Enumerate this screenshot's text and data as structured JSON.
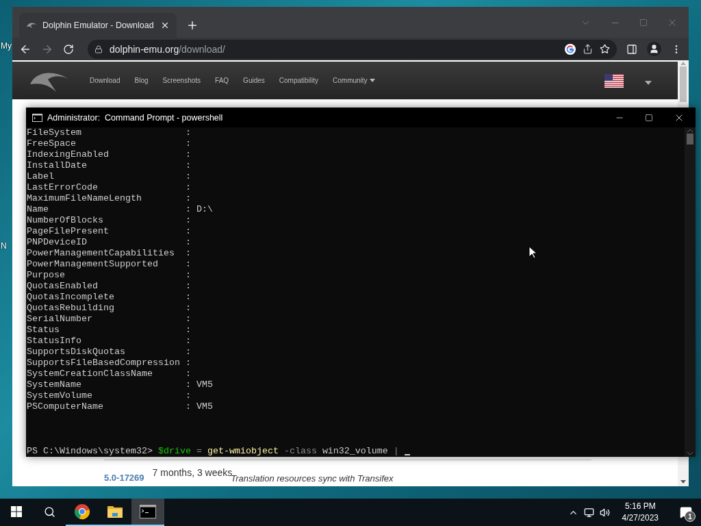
{
  "desktop": {
    "icon_labels": [
      "My",
      "N"
    ]
  },
  "browser": {
    "tab": {
      "title": "Dolphin Emulator - Download"
    },
    "address": {
      "host": "dolphin-emu.org",
      "path": "/download/"
    },
    "site_nav": [
      {
        "label": "Download",
        "kind": "link"
      },
      {
        "label": "Blog",
        "kind": "link"
      },
      {
        "label": "Screenshots",
        "kind": "link"
      },
      {
        "label": "FAQ",
        "kind": "link"
      },
      {
        "label": "Guides",
        "kind": "link"
      },
      {
        "label": "Compatibility",
        "kind": "link"
      },
      {
        "label": "Community",
        "kind": "dropdown"
      }
    ],
    "build_row": {
      "version": "5.0-17269",
      "age": "7 months, 3 weeks",
      "message": "Translation resources sync with Transifex"
    }
  },
  "console": {
    "title": "Administrator:  Command Prompt - powershell",
    "rows": [
      {
        "key": "FileSystem",
        "separator": ":",
        "value": ""
      },
      {
        "key": "FreeSpace",
        "separator": ":",
        "value": ""
      },
      {
        "key": "IndexingEnabled",
        "separator": ":",
        "value": ""
      },
      {
        "key": "InstallDate",
        "separator": ":",
        "value": ""
      },
      {
        "key": "Label",
        "separator": ":",
        "value": ""
      },
      {
        "key": "LastErrorCode",
        "separator": ":",
        "value": ""
      },
      {
        "key": "MaximumFileNameLength",
        "separator": ":",
        "value": ""
      },
      {
        "key": "Name",
        "separator": ":",
        "value": "D:\\"
      },
      {
        "key": "NumberOfBlocks",
        "separator": ":",
        "value": ""
      },
      {
        "key": "PageFilePresent",
        "separator": ":",
        "value": ""
      },
      {
        "key": "PNPDeviceID",
        "separator": ":",
        "value": ""
      },
      {
        "key": "PowerManagementCapabilities",
        "separator": ":",
        "value": ""
      },
      {
        "key": "PowerManagementSupported",
        "separator": ":",
        "value": ""
      },
      {
        "key": "Purpose",
        "separator": ":",
        "value": ""
      },
      {
        "key": "QuotasEnabled",
        "separator": ":",
        "value": ""
      },
      {
        "key": "QuotasIncomplete",
        "separator": ":",
        "value": ""
      },
      {
        "key": "QuotasRebuilding",
        "separator": ":",
        "value": ""
      },
      {
        "key": "SerialNumber",
        "separator": ":",
        "value": ""
      },
      {
        "key": "Status",
        "separator": ":",
        "value": ""
      },
      {
        "key": "StatusInfo",
        "separator": ":",
        "value": ""
      },
      {
        "key": "SupportsDiskQuotas",
        "separator": ":",
        "value": ""
      },
      {
        "key": "SupportsFileBasedCompression",
        "separator": ":",
        "value": ""
      },
      {
        "key": "SystemCreationClassName",
        "separator": ":",
        "value": ""
      },
      {
        "key": "SystemName",
        "separator": ":",
        "value": "VM5"
      },
      {
        "key": "SystemVolume",
        "separator": ":",
        "value": ""
      },
      {
        "key": "PSComputerName",
        "separator": ":",
        "value": "VM5"
      }
    ],
    "prompt": [
      {
        "text": "PS C:\\Windows\\system32>",
        "kind": "prompt"
      },
      {
        "text": "$drive",
        "kind": "variable"
      },
      {
        "text": "=",
        "kind": "operator"
      },
      {
        "text": "get-wmiobject",
        "kind": "command"
      },
      {
        "text": "-class",
        "kind": "parameter"
      },
      {
        "text": "win32_volume",
        "kind": "argument"
      },
      {
        "text": "|",
        "kind": "operator"
      }
    ]
  },
  "taskbar": {
    "apps": [
      {
        "kind": "browser",
        "selected": false
      },
      {
        "kind": "folder",
        "selected": false
      },
      {
        "kind": "terminal",
        "selected": true
      }
    ],
    "clock": {
      "time": "5:16 PM",
      "date": "4/27/2023"
    },
    "notifications": "1"
  }
}
